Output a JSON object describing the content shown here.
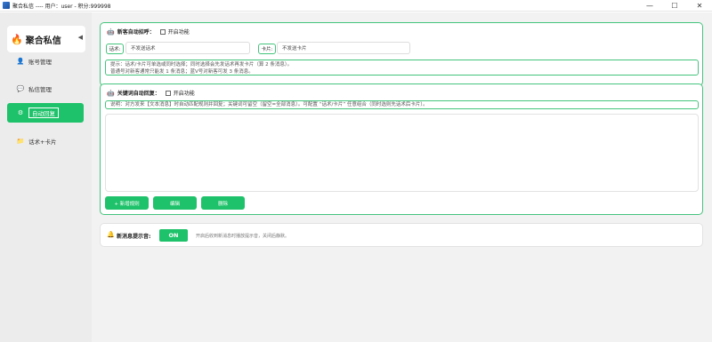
{
  "window": {
    "title": "聚合私信 ---- 用户：user - 积分:999998",
    "minimize": "—",
    "maximize": "☐",
    "close": "✕"
  },
  "sidebar": {
    "brand": "聚合私信",
    "collapse": "◀",
    "items": [
      {
        "label": "账号管理",
        "icon": "user-icon"
      },
      {
        "label": "私信管理",
        "icon": "chat-icon"
      },
      {
        "label": "自动回复",
        "icon": "robot-icon",
        "active": true
      },
      {
        "label": "话术+卡片",
        "icon": "folder-icon"
      }
    ]
  },
  "new_guest": {
    "title": "新客自动招呼：",
    "enable_label": "开启功能",
    "script_tag": "话术:",
    "script_value": "不发送话术",
    "card_tag": "卡片:",
    "card_value": "不发送卡片",
    "hint_line1": "提示：话术/卡片可单选或同时选择；同时选择会先发话术再发卡片（算 2 条消息）。",
    "hint_line2": "普通号对新客通常只能发 1 条消息；蓝V号对新客可发 3 条消息。"
  },
  "keyword_reply": {
    "title": "关键词自动回复：",
    "enable_label": "开启功能",
    "desc": "说明：对方发来【文本消息】时自动匹配规则并回复；关键词可留空（留空=全部消息）。可配置 “话术/卡片” 任意组合（同时选则先话术后卡片）。",
    "btn_add": "+ 新增规则",
    "btn_edit": "编辑",
    "btn_delete": "删除"
  },
  "notify": {
    "label": "新消息提示音:",
    "toggle": "ON",
    "desc": "开启后收到新消息时播放提示音，关闭后静默。"
  },
  "colors": {
    "accent": "#1ec26a",
    "border": "#44c47c"
  }
}
